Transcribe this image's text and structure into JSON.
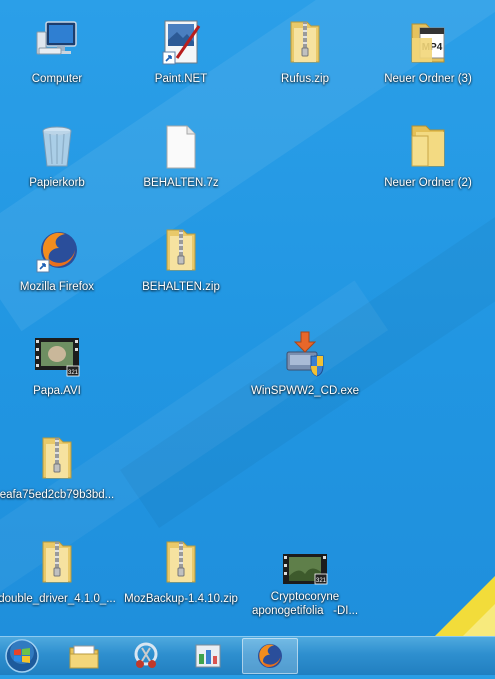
{
  "desktop": {
    "icons": [
      {
        "label": "Computer",
        "icon": "computer-icon"
      },
      {
        "label": "Paint.NET",
        "icon": "paintnet-icon"
      },
      {
        "label": "Rufus.zip",
        "icon": "zip-folder-icon"
      },
      {
        "label": "Neuer Ordner (3)",
        "icon": "mp4-folder-icon"
      },
      {
        "label": "Papierkorb",
        "icon": "recycle-bin-icon"
      },
      {
        "label": "BEHALTEN.7z",
        "icon": "blank-file-icon"
      },
      {
        "label": "Neuer Ordner (2)",
        "icon": "folder-icon"
      },
      {
        "label": "Mozilla Firefox",
        "icon": "firefox-icon"
      },
      {
        "label": "BEHALTEN.zip",
        "icon": "zip-folder-icon"
      },
      {
        "label": "Papa.AVI",
        "icon": "video-file-icon"
      },
      {
        "label": "WinSPWW2_CD.exe",
        "icon": "installer-icon"
      },
      {
        "label": "eafa75ed2cb79b3bd...",
        "icon": "zip-folder-icon"
      },
      {
        "label": "double_driver_4.1.0_...",
        "icon": "zip-folder-icon"
      },
      {
        "label": "MozBackup-1.4.10.zip",
        "icon": "zip-folder-icon"
      },
      {
        "label": "Cryptocoryne aponogetifolia -DI...",
        "label_line1": "Cryptocoryne",
        "label_line2": "aponogetifolia   -DI...",
        "icon": "video-file-icon"
      }
    ]
  },
  "taskbar": {
    "start": "start-orb-icon",
    "pinned": [
      "file-explorer-icon",
      "snipping-tool-icon",
      "control-panel-icon",
      "firefox-icon"
    ],
    "active": "firefox-icon"
  },
  "colors": {
    "desktop": "#2196e2",
    "taskbar": "#2e8fcf",
    "corner": "#f2dc3a"
  }
}
